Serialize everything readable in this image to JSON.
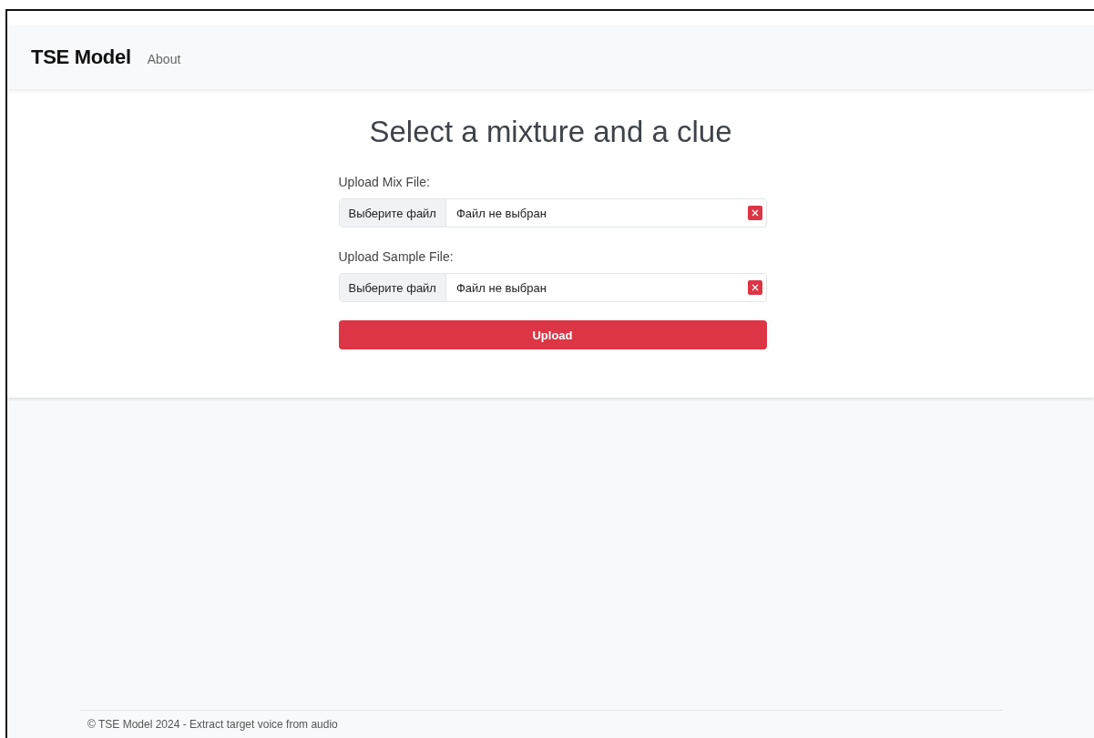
{
  "navbar": {
    "brand": "TSE Model",
    "links": [
      {
        "label": "About"
      }
    ]
  },
  "title": "Select a mixture and a clue",
  "uploads": [
    {
      "label": "Upload Mix File:",
      "button": "Выберите файл",
      "status": "Файл не выбран"
    },
    {
      "label": "Upload Sample File:",
      "button": "Выберите файл",
      "status": "Файл не выбран"
    }
  ],
  "submit": "Upload",
  "footer": "© TSE Model 2024 - Extract target voice from audio"
}
